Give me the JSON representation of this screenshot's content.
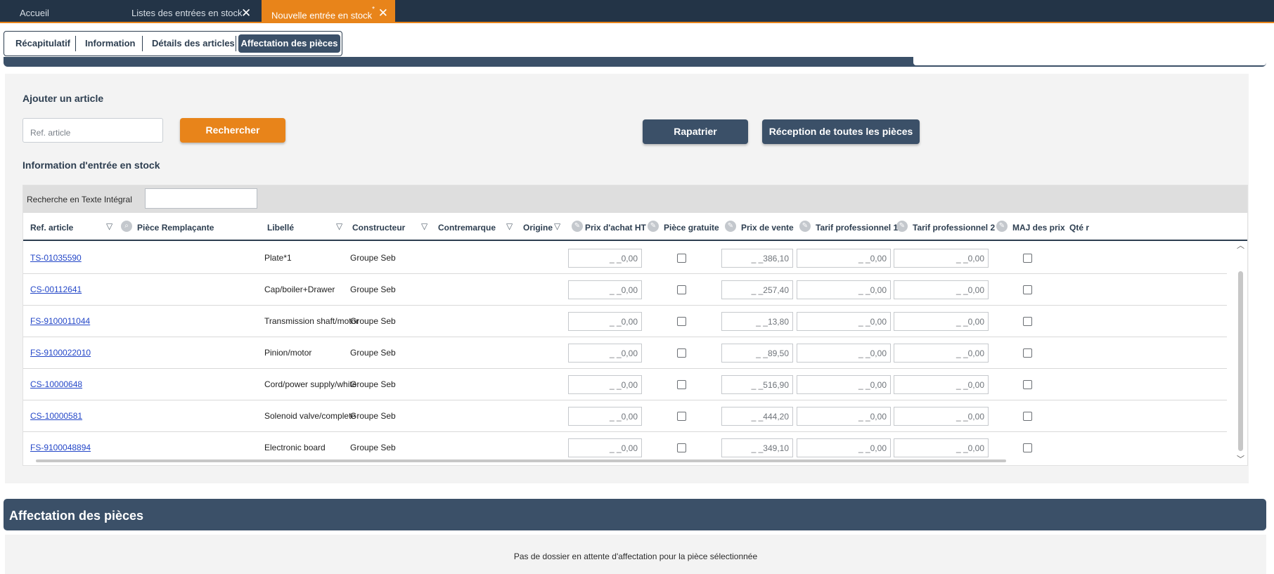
{
  "top_tabs": {
    "home": "Accueil",
    "list": "Listes des entrées en stock",
    "new": "Nouvelle entrée en stock",
    "new_modified_marker": "*",
    "close_glyph": "✕"
  },
  "sub_tabs": [
    "Récapitulatif",
    "Information",
    "Détails des articles",
    "Affectation des pièces"
  ],
  "add_article": {
    "title": "Ajouter un article",
    "ref_placeholder": "Ref. article",
    "search_button": "Rechercher",
    "repatriate_button": "Rapatrier",
    "receive_all_button": "Réception de toutes les pièces"
  },
  "stock_info": {
    "title": "Information d'entrée en stock",
    "fulltext_label": "Recherche en Texte Intégral",
    "columns": {
      "ref": "Ref. article",
      "replacement": "Pièce Remplaçante",
      "label": "Libellé",
      "maker": "Constructeur",
      "brand": "Contremarque",
      "origin": "Origine",
      "purchase_price": "Prix d'achat HT",
      "free_part": "Pièce gratuite",
      "sale_price": "Prix de vente",
      "pro_rate_1": "Tarif professionnel 1",
      "pro_rate_2": "Tarif professionnel 2",
      "price_update": "MAJ des prix",
      "qty": "Qté r"
    },
    "rows": [
      {
        "ref": "TS-01035590",
        "label": "Plate*1",
        "maker": "Groupe Seb",
        "purchase": "_ _0,00",
        "sale": "_ _386,10",
        "pro1": "_ _0,00",
        "pro2": "_ _0,00"
      },
      {
        "ref": "CS-00112641",
        "label": "Cap/boiler+Drawer",
        "maker": "Groupe Seb",
        "purchase": "_ _0,00",
        "sale": "_ _257,40",
        "pro1": "_ _0,00",
        "pro2": "_ _0,00"
      },
      {
        "ref": "FS-9100011044",
        "label": "Transmission shaft/motor",
        "maker": "Groupe Seb",
        "purchase": "_ _0,00",
        "sale": "_ _13,80",
        "pro1": "_ _0,00",
        "pro2": "_ _0,00"
      },
      {
        "ref": "FS-9100022010",
        "label": "Pinion/motor",
        "maker": "Groupe Seb",
        "purchase": "_ _0,00",
        "sale": "_ _89,50",
        "pro1": "_ _0,00",
        "pro2": "_ _0,00"
      },
      {
        "ref": "CS-10000648",
        "label": "Cord/power supply/white",
        "maker": "Groupe Seb",
        "purchase": "_ _0,00",
        "sale": "_ _516,90",
        "pro1": "_ _0,00",
        "pro2": "_ _0,00"
      },
      {
        "ref": "CS-10000581",
        "label": "Solenoid valve/complete",
        "maker": "Groupe Seb",
        "purchase": "_ _0,00",
        "sale": "_ _444,20",
        "pro1": "_ _0,00",
        "pro2": "_ _0,00"
      },
      {
        "ref": "FS-9100048894",
        "label": "Electronic board",
        "maker": "Groupe Seb",
        "purchase": "_ _0,00",
        "sale": "_ _349,10",
        "pro1": "_ _0,00",
        "pro2": "_ _0,00"
      }
    ]
  },
  "allocation": {
    "title": "Affectation des pièces",
    "empty_message": "Pas de dossier en attente d'affectation pour la pièce sélectionnée"
  },
  "icons": {
    "filter": "funnel-icon",
    "search": "magnifier-icon",
    "edit": "pencil-icon"
  },
  "colors": {
    "navy": "#3b5068",
    "dark_navy": "#233447",
    "orange": "#e8841a",
    "link": "#2447c8"
  }
}
